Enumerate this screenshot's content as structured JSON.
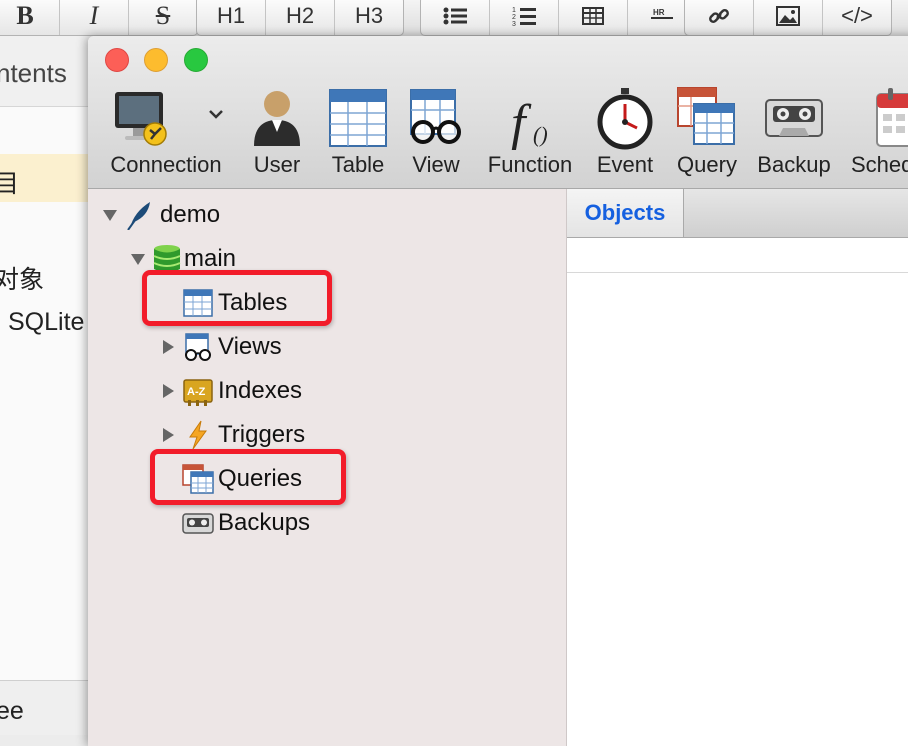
{
  "editor": {
    "toolbar": [
      "B",
      "I",
      "S",
      "H1",
      "H2",
      "H3",
      "ul",
      "ol",
      "table",
      "hr",
      "link",
      "image",
      "</>"
    ],
    "sidebar_title": "ntents",
    "sidebar_lines": [
      "目",
      "对象",
      "SQLite"
    ],
    "footer": "ee"
  },
  "window": {
    "toolbar": [
      {
        "label": "Connection",
        "icon": "monitor-plug-icon"
      },
      {
        "label": "User",
        "icon": "user-icon"
      },
      {
        "label": "Table",
        "icon": "table-icon"
      },
      {
        "label": "View",
        "icon": "view-glasses-icon"
      },
      {
        "label": "Function",
        "icon": "function-icon"
      },
      {
        "label": "Event",
        "icon": "stopwatch-icon"
      },
      {
        "label": "Query",
        "icon": "query-icon"
      },
      {
        "label": "Backup",
        "icon": "cassette-icon"
      },
      {
        "label": "Sched",
        "icon": "calendar-icon"
      }
    ]
  },
  "tree": {
    "connection": "demo",
    "database": "main",
    "items": [
      {
        "label": "Tables",
        "icon": "table-icon"
      },
      {
        "label": "Views",
        "icon": "view-glasses-icon"
      },
      {
        "label": "Indexes",
        "icon": "index-az-icon"
      },
      {
        "label": "Triggers",
        "icon": "lightning-icon"
      },
      {
        "label": "Queries",
        "icon": "query-icon"
      },
      {
        "label": "Backups",
        "icon": "cassette-icon"
      }
    ]
  },
  "objects": {
    "tab": "Objects"
  },
  "colors": {
    "callout": "#f21c2a",
    "tab_text": "#1560e0"
  }
}
